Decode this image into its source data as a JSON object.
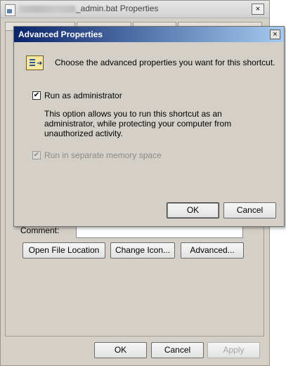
{
  "background_window": {
    "title_suffix": "_admin.bat Properties",
    "close_glyph": "×",
    "comment_label": "Comment:",
    "buttons": {
      "open_file_location": "Open File Location",
      "change_icon": "Change Icon...",
      "advanced": "Advanced..."
    },
    "footer_buttons": {
      "ok": "OK",
      "cancel": "Cancel",
      "apply": "Apply"
    }
  },
  "dialog": {
    "title": "Advanced Properties",
    "close_glyph": "×",
    "prompt": "Choose the advanced properties you want for this shortcut.",
    "run_as_admin": {
      "label": "Run as administrator",
      "checked": true,
      "check_glyph": "✔"
    },
    "description": "This option allows you to run this shortcut as an administrator, while protecting your computer from unauthorized activity.",
    "separate_memory": {
      "label": "Run in separate memory space",
      "checked": true,
      "disabled": true,
      "check_glyph": "✔"
    },
    "buttons": {
      "ok": "OK",
      "cancel": "Cancel"
    }
  },
  "icons": {
    "title_icon": "batch-file-icon",
    "prompt_icon": "shortcut-properties-icon"
  }
}
